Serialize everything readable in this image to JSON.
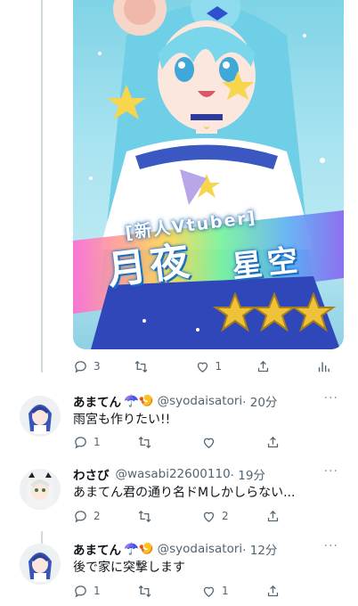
{
  "top_post": {
    "image": {
      "tag_text": "[新人Vtuber]",
      "name_left": "月夜",
      "name_right": "星空"
    },
    "actions": {
      "reply_count": "3",
      "retweet_count": "",
      "like_count": "1"
    }
  },
  "replies": [
    {
      "display_name": "あまてん",
      "emojis": "☂️🍤",
      "handle": "@syodaisatori",
      "time": "· 20分",
      "text": "雨宮も作りたい!!",
      "actions": {
        "reply_count": "1",
        "retweet_count": "",
        "like_count": ""
      }
    },
    {
      "display_name": "わさび",
      "emojis": "",
      "handle": "@wasabi22600110",
      "time": "· 19分",
      "text": "あまてん君の通り名ドMしかしらない...",
      "actions": {
        "reply_count": "2",
        "retweet_count": "",
        "like_count": "2"
      }
    },
    {
      "display_name": "あまてん",
      "emojis": "☂️🍤",
      "handle": "@syodaisatori",
      "time": "· 12分",
      "text": "後で家に突撃します",
      "actions": {
        "reply_count": "1",
        "retweet_count": "",
        "like_count": "1"
      }
    }
  ],
  "more_label": "···",
  "icons": {
    "reply": "reply-icon",
    "retweet": "retweet-icon",
    "like": "heart-icon",
    "share": "share-icon",
    "analytics": "analytics-icon"
  },
  "colors": {
    "icon_gray": "#536471",
    "thread_line": "#cfd9de",
    "name_glow": "#1c6fc0"
  }
}
